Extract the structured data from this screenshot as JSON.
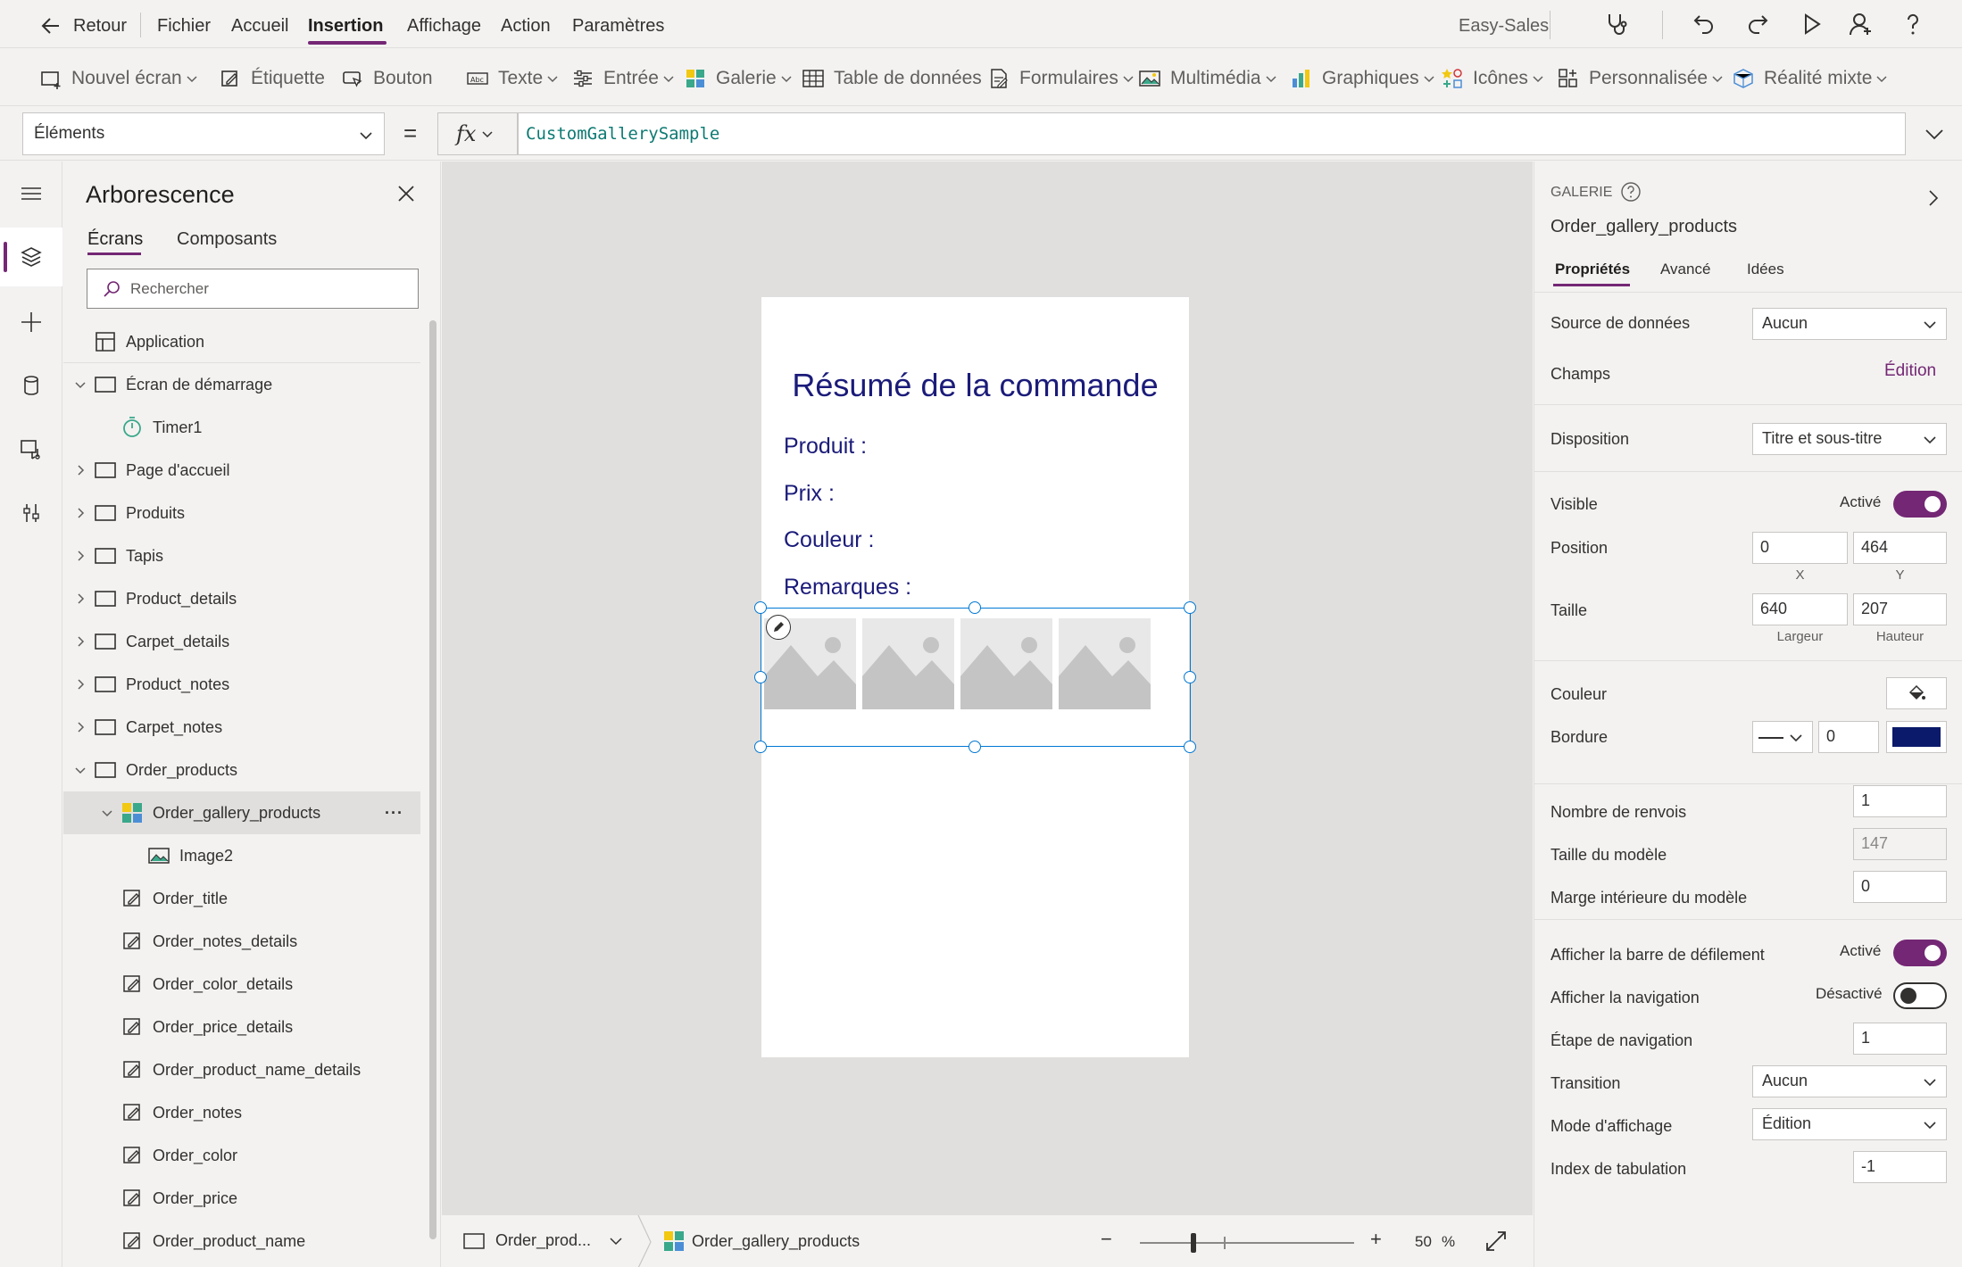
{
  "menubar": {
    "back_label": "Retour",
    "items": [
      "Fichier",
      "Accueil",
      "Insertion",
      "Affichage",
      "Action",
      "Paramètres"
    ],
    "active_item": "Insertion",
    "app_name": "Easy-Sales"
  },
  "ribbon": {
    "items": [
      {
        "label": "Nouvel écran",
        "icon": "new-screen-icon",
        "dropdown": true
      },
      {
        "label": "Étiquette",
        "icon": "label-icon",
        "dropdown": false
      },
      {
        "label": "Bouton",
        "icon": "button-icon",
        "dropdown": false
      },
      {
        "label": "Texte",
        "icon": "text-icon",
        "dropdown": true
      },
      {
        "label": "Entrée",
        "icon": "input-icon",
        "dropdown": true
      },
      {
        "label": "Galerie",
        "icon": "gallery-icon",
        "dropdown": true
      },
      {
        "label": "Table de données",
        "icon": "data-table-icon",
        "dropdown": false
      },
      {
        "label": "Formulaires",
        "icon": "forms-icon",
        "dropdown": true
      },
      {
        "label": "Multimédia",
        "icon": "media-icon",
        "dropdown": true
      },
      {
        "label": "Graphiques",
        "icon": "charts-icon",
        "dropdown": true
      },
      {
        "label": "Icônes",
        "icon": "icons-icon",
        "dropdown": true
      },
      {
        "label": "Personnalisée",
        "icon": "custom-icon",
        "dropdown": true
      },
      {
        "label": "Réalité mixte",
        "icon": "mixed-reality-icon",
        "dropdown": true
      }
    ]
  },
  "formula_bar": {
    "property": "Éléments",
    "equals": "=",
    "fx": "fx",
    "formula": "CustomGallerySample"
  },
  "tree": {
    "title": "Arborescence",
    "tabs": [
      "Écrans",
      "Composants"
    ],
    "active_tab": "Écrans",
    "search_placeholder": "Rechercher",
    "items": [
      {
        "label": "Application",
        "type": "app",
        "level": 0,
        "expander": "none"
      },
      {
        "label": "Écran de démarrage",
        "type": "screen",
        "level": 0,
        "expander": "expanded"
      },
      {
        "label": "Timer1",
        "type": "timer",
        "level": 1,
        "expander": "none"
      },
      {
        "label": "Page d'accueil",
        "type": "screen",
        "level": 0,
        "expander": "collapsed"
      },
      {
        "label": "Produits",
        "type": "screen",
        "level": 0,
        "expander": "collapsed"
      },
      {
        "label": "Tapis",
        "type": "screen",
        "level": 0,
        "expander": "collapsed"
      },
      {
        "label": "Product_details",
        "type": "screen",
        "level": 0,
        "expander": "collapsed"
      },
      {
        "label": "Carpet_details",
        "type": "screen",
        "level": 0,
        "expander": "collapsed"
      },
      {
        "label": "Product_notes",
        "type": "screen",
        "level": 0,
        "expander": "collapsed"
      },
      {
        "label": "Carpet_notes",
        "type": "screen",
        "level": 0,
        "expander": "collapsed"
      },
      {
        "label": "Order_products",
        "type": "screen",
        "level": 0,
        "expander": "expanded"
      },
      {
        "label": "Order_gallery_products",
        "type": "gallery",
        "level": 1,
        "expander": "expanded",
        "selected": true,
        "more": "···"
      },
      {
        "label": "Image2",
        "type": "image",
        "level": 2,
        "expander": "none"
      },
      {
        "label": "Order_title",
        "type": "label",
        "level": 1,
        "expander": "none"
      },
      {
        "label": "Order_notes_details",
        "type": "label",
        "level": 1,
        "expander": "none"
      },
      {
        "label": "Order_color_details",
        "type": "label",
        "level": 1,
        "expander": "none"
      },
      {
        "label": "Order_price_details",
        "type": "label",
        "level": 1,
        "expander": "none"
      },
      {
        "label": "Order_product_name_details",
        "type": "label",
        "level": 1,
        "expander": "none"
      },
      {
        "label": "Order_notes",
        "type": "label",
        "level": 1,
        "expander": "none"
      },
      {
        "label": "Order_color",
        "type": "label",
        "level": 1,
        "expander": "none"
      },
      {
        "label": "Order_price",
        "type": "label",
        "level": 1,
        "expander": "none"
      },
      {
        "label": "Order_product_name",
        "type": "label",
        "level": 1,
        "expander": "none"
      }
    ]
  },
  "canvas": {
    "screen_title": "Résumé de la commande",
    "fields": [
      "Produit :",
      "Prix :",
      "Couleur :",
      "Remarques :"
    ],
    "gallery_image_count": 4,
    "title_color": "#1b1b7a"
  },
  "status": {
    "screen_selector": "Order_prod...",
    "selected_control": "Order_gallery_products",
    "zoom_minus": "−",
    "zoom_plus": "+",
    "zoom_value": "50",
    "zoom_unit": "%",
    "zoom_fraction": 0.25
  },
  "props": {
    "type_label": "GALERIE",
    "control_name": "Order_gallery_products",
    "tabs": [
      "Propriétés",
      "Avancé",
      "Idées"
    ],
    "active_tab": "Propriétés",
    "data_source_label": "Source de données",
    "data_source_value": "Aucun",
    "fields_label": "Champs",
    "fields_link": "Édition",
    "layout_label": "Disposition",
    "layout_value": "Titre et sous-titre",
    "visible_label": "Visible",
    "visible_state": "Activé",
    "position_label": "Position",
    "position_x": "0",
    "position_y": "464",
    "x_caption": "X",
    "y_caption": "Y",
    "size_label": "Taille",
    "size_width": "640",
    "size_height": "207",
    "width_caption": "Largeur",
    "height_caption": "Hauteur",
    "color_label": "Couleur",
    "border_label": "Bordure",
    "border_width": "0",
    "border_color": "#0b1a6b",
    "wrap_count_label": "Nombre de renvois",
    "wrap_count": "1",
    "template_size_label": "Taille du modèle",
    "template_size": "147",
    "template_padding_label": "Marge intérieure du modèle",
    "template_padding": "0",
    "scrollbar_label": "Afficher la barre de défilement",
    "scrollbar_state": "Activé",
    "navigation_label": "Afficher la navigation",
    "navigation_state": "Désactivé",
    "nav_step_label": "Étape de navigation",
    "nav_step": "1",
    "transition_label": "Transition",
    "transition_value": "Aucun",
    "display_mode_label": "Mode d'affichage",
    "display_mode_value": "Édition",
    "tab_index_label": "Index de tabulation",
    "tab_index": "-1"
  },
  "colors": {
    "accent": "#742774",
    "selection": "#0078d4",
    "formula": "#0e7a73"
  }
}
